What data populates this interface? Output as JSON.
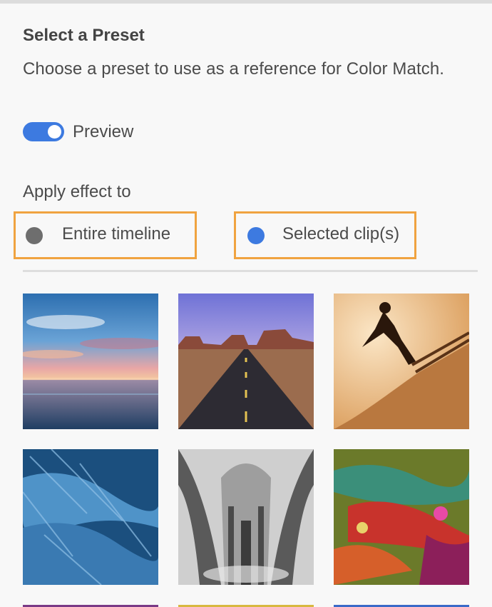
{
  "panel": {
    "title": "Select a Preset",
    "description": "Choose a preset to use as a reference for Color Match."
  },
  "preview": {
    "label": "Preview",
    "enabled": true
  },
  "apply_effect": {
    "label": "Apply effect to",
    "options": [
      {
        "label": "Entire timeline",
        "selected": false
      },
      {
        "label": "Selected clip(s)",
        "selected": true
      }
    ]
  },
  "colors": {
    "accent_blue": "#3d7ae0",
    "highlight_orange": "#f0a340",
    "radio_unselected": "#6e6e6e"
  },
  "presets": [
    {
      "icon": "sunset-sea-photo"
    },
    {
      "icon": "desert-road-photo"
    },
    {
      "icon": "skateboarder-silhouette-photo"
    },
    {
      "icon": "blue-feathers-photo"
    },
    {
      "icon": "cathedral-arches-bw-photo"
    },
    {
      "icon": "abstract-paint-photo"
    }
  ]
}
